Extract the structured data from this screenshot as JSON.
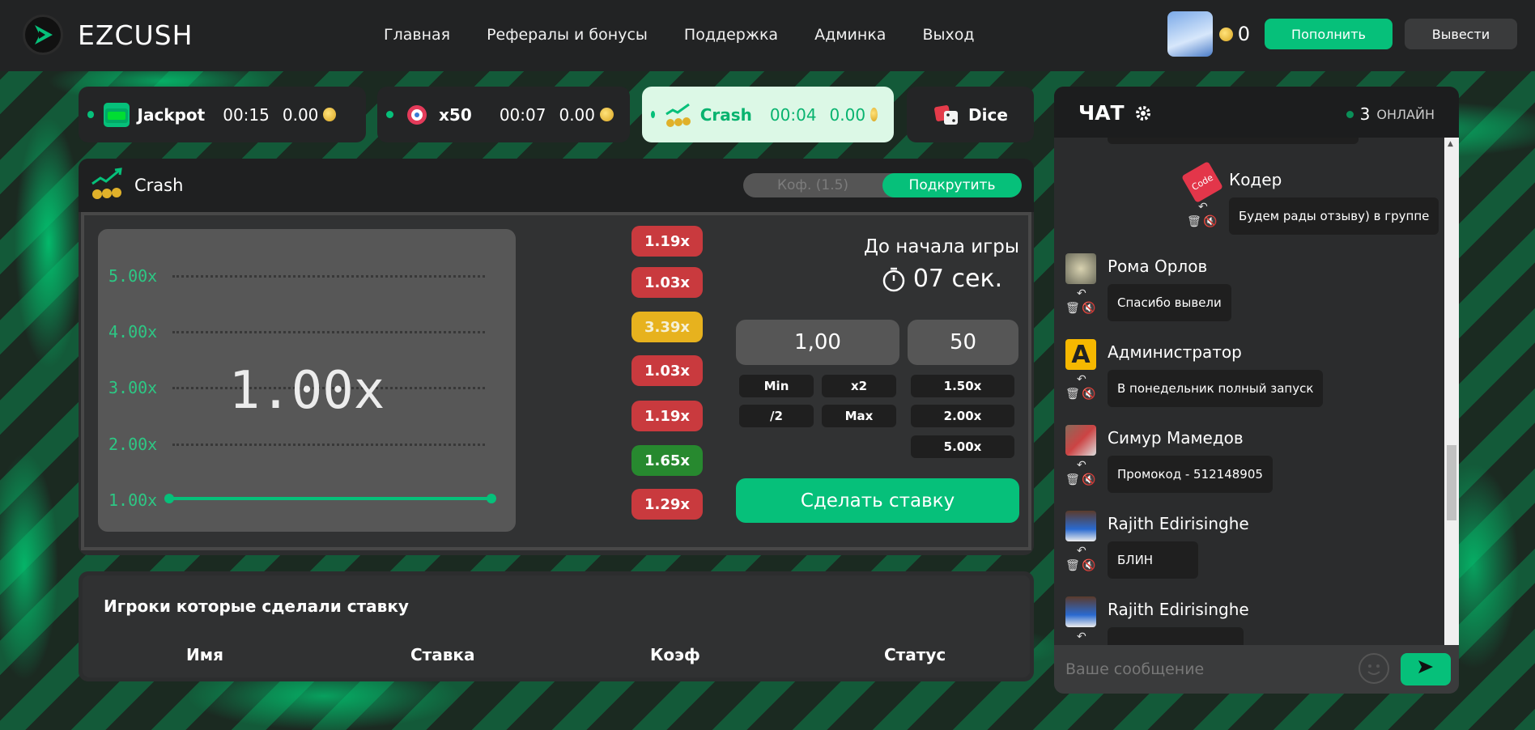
{
  "header": {
    "logo_text": "EZCUSH",
    "nav": [
      "Главная",
      "Рефералы и бонусы",
      "Поддержка",
      "Админка",
      "Выход"
    ],
    "balance": "0",
    "deposit_label": "Пополнить",
    "withdraw_label": "Вывести"
  },
  "games": [
    {
      "name": "Jackpot",
      "time": "00:15",
      "sum": "0.00"
    },
    {
      "name": "x50",
      "time": "00:07",
      "sum": "0.00"
    },
    {
      "name": "Crash",
      "time": "00:04",
      "sum": "0.00"
    },
    {
      "name": "Dice"
    }
  ],
  "crash": {
    "title": "Crash",
    "toggle_left": "Коф. (1.5)",
    "toggle_right": "Подкрутить",
    "y_labels": [
      "5.00x",
      "4.00x",
      "3.00x",
      "2.00x",
      "1.00x"
    ],
    "multiplier": "1.00x",
    "history": [
      {
        "value": "1.19x",
        "color": "red"
      },
      {
        "value": "1.03x",
        "color": "red"
      },
      {
        "value": "3.39x",
        "color": "yellow"
      },
      {
        "value": "1.03x",
        "color": "red"
      },
      {
        "value": "1.19x",
        "color": "red"
      },
      {
        "value": "1.65x",
        "color": "green"
      },
      {
        "value": "1.29x",
        "color": "red"
      }
    ],
    "countdown_label": "До начала игры",
    "countdown_value": "07 сек.",
    "bet_amount": "1,00",
    "auto_cashout": "50",
    "btn_min": "Min",
    "btn_x2": "x2",
    "btn_half": "/2",
    "btn_max": "Max",
    "preset_1": "1.50x",
    "preset_2": "2.00x",
    "preset_3": "5.00x",
    "bet_label": "Сделать ставку"
  },
  "players": {
    "title": "Игроки которые сделали ставку",
    "columns": [
      "Имя",
      "Ставка",
      "Коэф",
      "Статус"
    ]
  },
  "chat": {
    "title": "ЧАТ",
    "online_count": "3",
    "online_label": "ОНЛАЙН",
    "messages": [
      {
        "name": "Кодер",
        "text": "Будем рады отзыву) в группе"
      },
      {
        "name": "Рома Орлов",
        "text": "Спасибо вывели"
      },
      {
        "name": "Администратор",
        "text": "В понедельник полный запуск"
      },
      {
        "name": "Симур Мамедов",
        "text": "Промокод - 512148905"
      },
      {
        "name": "Rajith Edirisinghe",
        "text": "БЛИН"
      },
      {
        "name": "Rajith Edirisinghe",
        "text": ""
      }
    ],
    "input_placeholder": "Ваше сообщение"
  },
  "colors": {
    "accent": "#06c07a",
    "red": "#c93a3e",
    "yellow": "#e7b21e",
    "green": "#27892f"
  }
}
